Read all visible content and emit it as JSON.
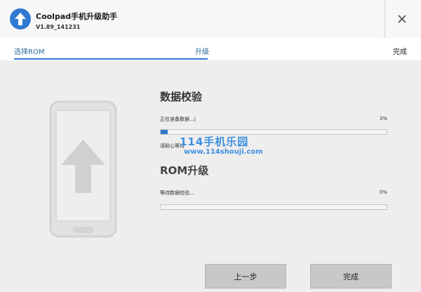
{
  "app": {
    "title": "Coolpad手机升级助手",
    "version": "V1.89_141231"
  },
  "steps": {
    "select_rom": "选择ROM",
    "upgrade": "升级",
    "done": "完成"
  },
  "verify": {
    "title": "数据校验",
    "status": "正在准备数据...|",
    "percent_label": "3%",
    "progress": 0.03,
    "notice": "请耐心等待"
  },
  "rom": {
    "title": "ROM升级",
    "status": "等待数据校验...",
    "percent_label": "0%",
    "progress": 0.0
  },
  "watermark": {
    "title": "114手机乐园",
    "url": "www.114shouji.com"
  },
  "buttons": {
    "previous": "上一步",
    "finish": "完成"
  },
  "colors": {
    "accent": "#2f79d0",
    "background": "#eeeeee",
    "button": "#c8c8c8"
  },
  "icons": {
    "logo": "upload-arrow-icon",
    "close": "close-icon",
    "illustration": "phone-upgrade-illustration"
  }
}
